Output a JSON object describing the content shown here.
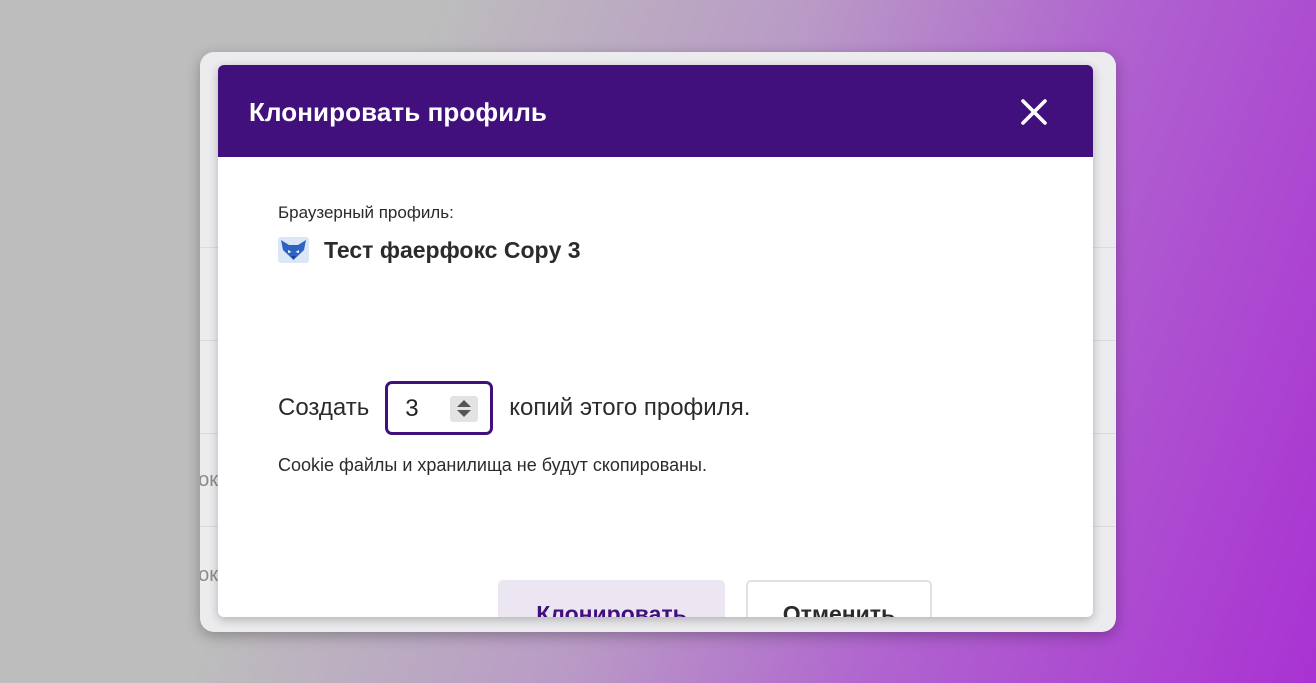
{
  "background_window": {
    "peek_rows": [
      "ок",
      "ок"
    ]
  },
  "dialog": {
    "title": "Клонировать профиль",
    "close_icon": "close-icon",
    "profile_label": "Браузерный профиль:",
    "profile_icon": "fox-icon",
    "profile_name": "Тест фаерфокс Copy 3",
    "create_prefix": "Создать",
    "copies_count": "3",
    "create_suffix": "копий этого профиля.",
    "cookie_note": "Cookie файлы и хранилища не будут скопированы.",
    "clone_button": "Клонировать",
    "cancel_button": "Отменить"
  },
  "colors": {
    "header": "#42107d",
    "accent": "#42107d",
    "clone_button_bg": "#ece6f2"
  }
}
